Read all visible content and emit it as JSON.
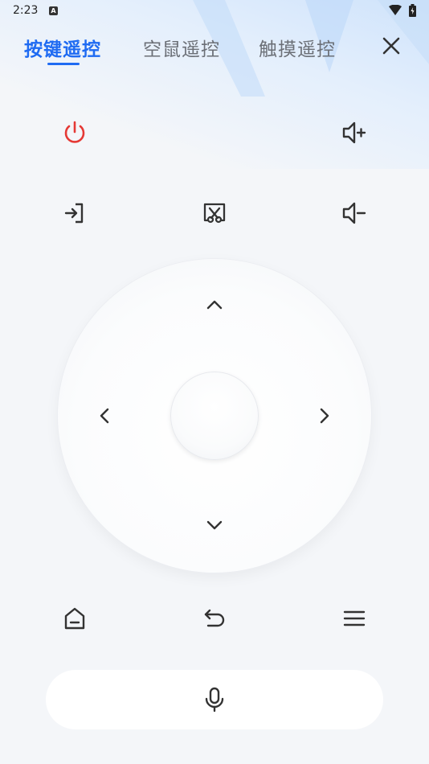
{
  "status_bar": {
    "time": "2:23",
    "notification_glyph": "A"
  },
  "tabs": [
    {
      "label": "按键遥控",
      "active": true
    },
    {
      "label": "空鼠遥控",
      "active": false
    },
    {
      "label": "触摸遥控",
      "active": false
    }
  ],
  "colors": {
    "accent": "#1f6bf2",
    "power": "#e53935",
    "icon": "#333333",
    "background": "#f4f6f9"
  },
  "buttons": {
    "power": "power-icon",
    "volume_up": "volume-up-icon",
    "input_source": "input-source-icon",
    "screenshot": "screenshot-icon",
    "volume_down": "volume-down-icon",
    "home": "home-icon",
    "back": "back-icon",
    "menu": "menu-icon",
    "voice": "microphone-icon",
    "close": "close-icon"
  }
}
